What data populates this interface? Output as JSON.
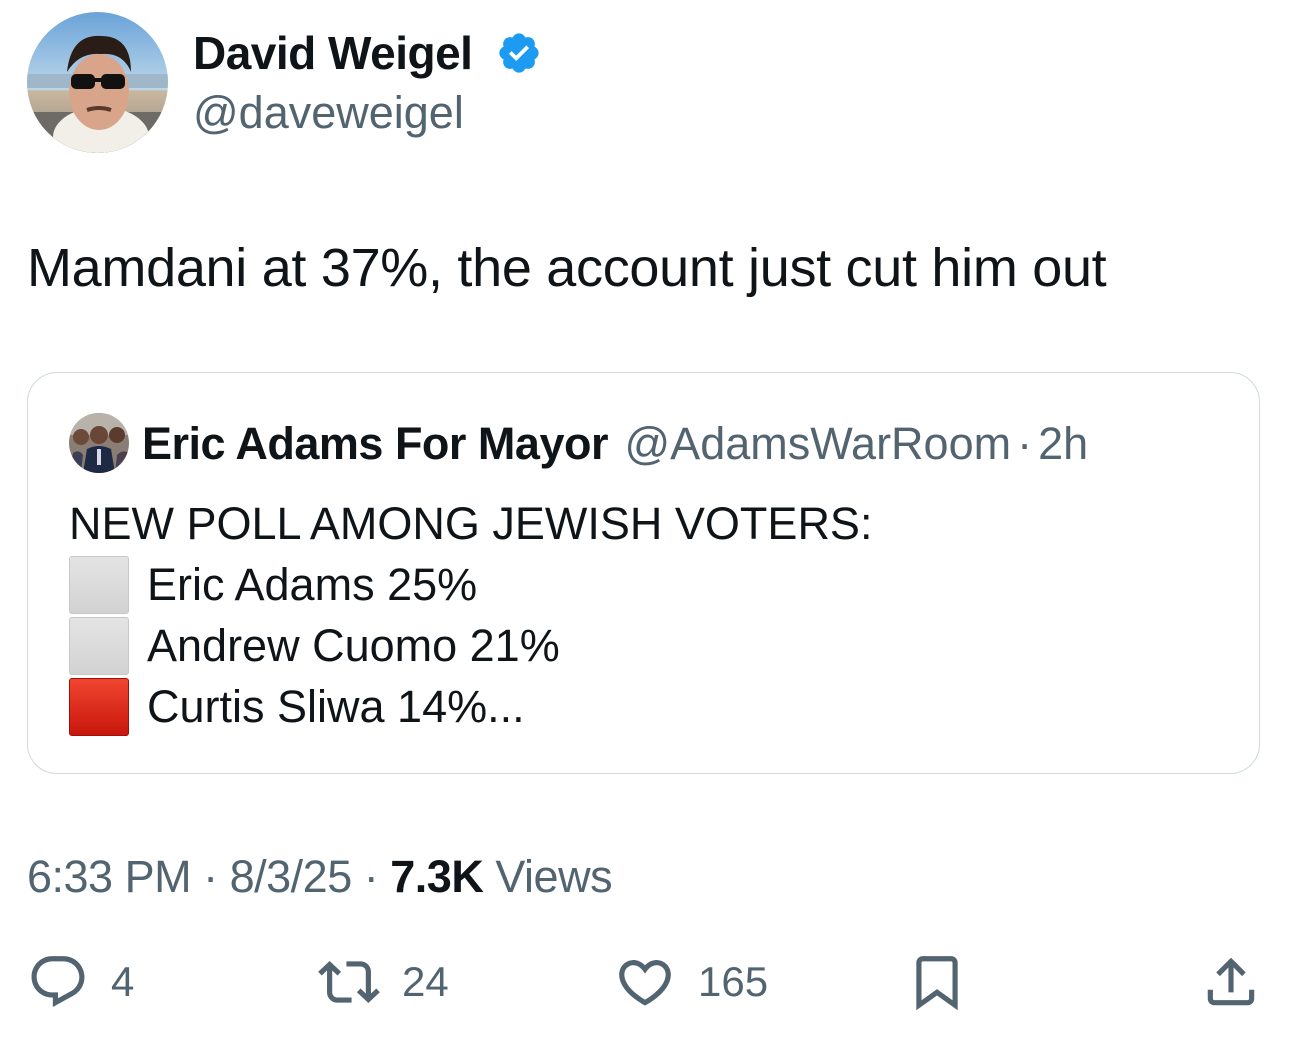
{
  "author": {
    "name": "David Weigel",
    "handle": "@daveweigel",
    "verified": true,
    "verified_color": "#1d9bf0",
    "avatar_icon": "profile-photo"
  },
  "tweet": {
    "text": "Mamdani at 37%, the account just cut him out"
  },
  "quote": {
    "name": "Eric Adams For Mayor",
    "handle": "@AdamsWarRoom",
    "separator": "·",
    "time": "2h",
    "lines": {
      "headline": "NEW POLL AMONG JEWISH VOTERS:",
      "row1": {
        "icon": "white-square-emoji",
        "text": "Eric Adams 25%"
      },
      "row2": {
        "icon": "white-square-emoji",
        "text": "Andrew Cuomo 21%"
      },
      "row3": {
        "icon": "red-square-emoji",
        "text": "Curtis Sliwa 14%..."
      }
    }
  },
  "meta": {
    "time": "6:33 PM",
    "sep1": "·",
    "date": "8/3/25",
    "sep2": "·",
    "views_count": "7.3K",
    "views_label": "Views"
  },
  "actions": {
    "reply": {
      "icon": "reply-icon",
      "count": "4"
    },
    "retweet": {
      "icon": "retweet-icon",
      "count": "24"
    },
    "like": {
      "icon": "heart-icon",
      "count": "165"
    },
    "bookmark": {
      "icon": "bookmark-icon"
    },
    "share": {
      "icon": "share-icon"
    }
  },
  "colors": {
    "text_primary": "#0f1419",
    "text_secondary": "#536471",
    "border": "#cfd9de",
    "accent_blue": "#1d9bf0"
  }
}
